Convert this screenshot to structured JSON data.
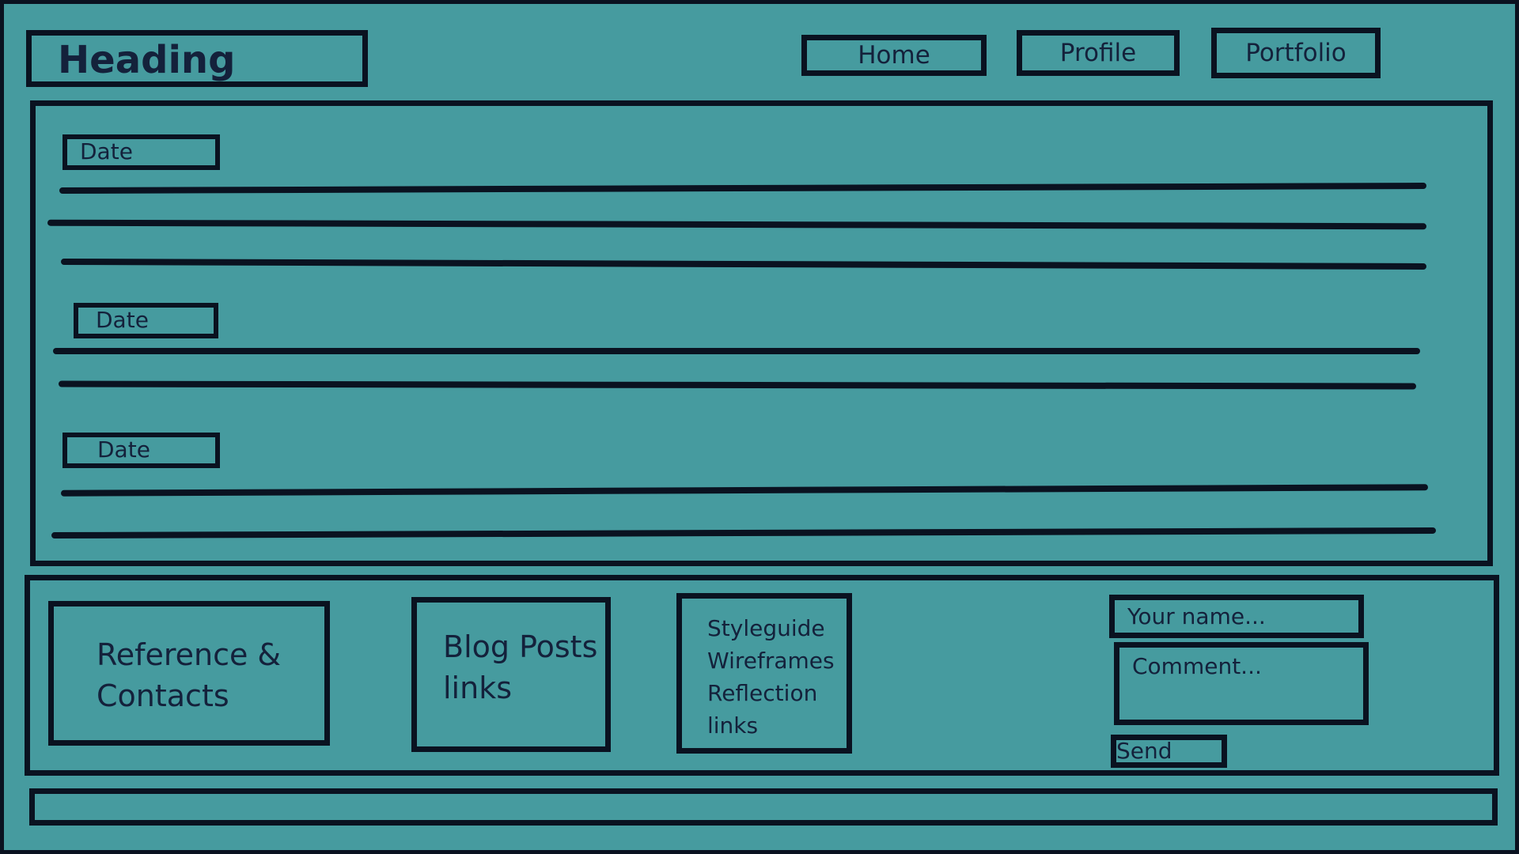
{
  "header": {
    "heading": "Heading",
    "nav": {
      "home": "Home",
      "profile": "Profile",
      "portfolio": "Portfolio"
    }
  },
  "main": {
    "posts": [
      {
        "date": "Date"
      },
      {
        "date": "Date"
      },
      {
        "date": "Date"
      }
    ]
  },
  "footer": {
    "reference_contacts": [
      "Reference &",
      "Contacts"
    ],
    "blog_posts": [
      "Blog Posts",
      "links"
    ],
    "styleguide_links": [
      "Styleguide",
      "Wireframes",
      "Reflection",
      "links"
    ],
    "form": {
      "name_placeholder": "Your name...",
      "comment_placeholder": "Comment...",
      "send_label": "Send"
    }
  },
  "colors": {
    "background": "#469b9f",
    "stroke": "#0a1220",
    "text": "#14213b"
  }
}
